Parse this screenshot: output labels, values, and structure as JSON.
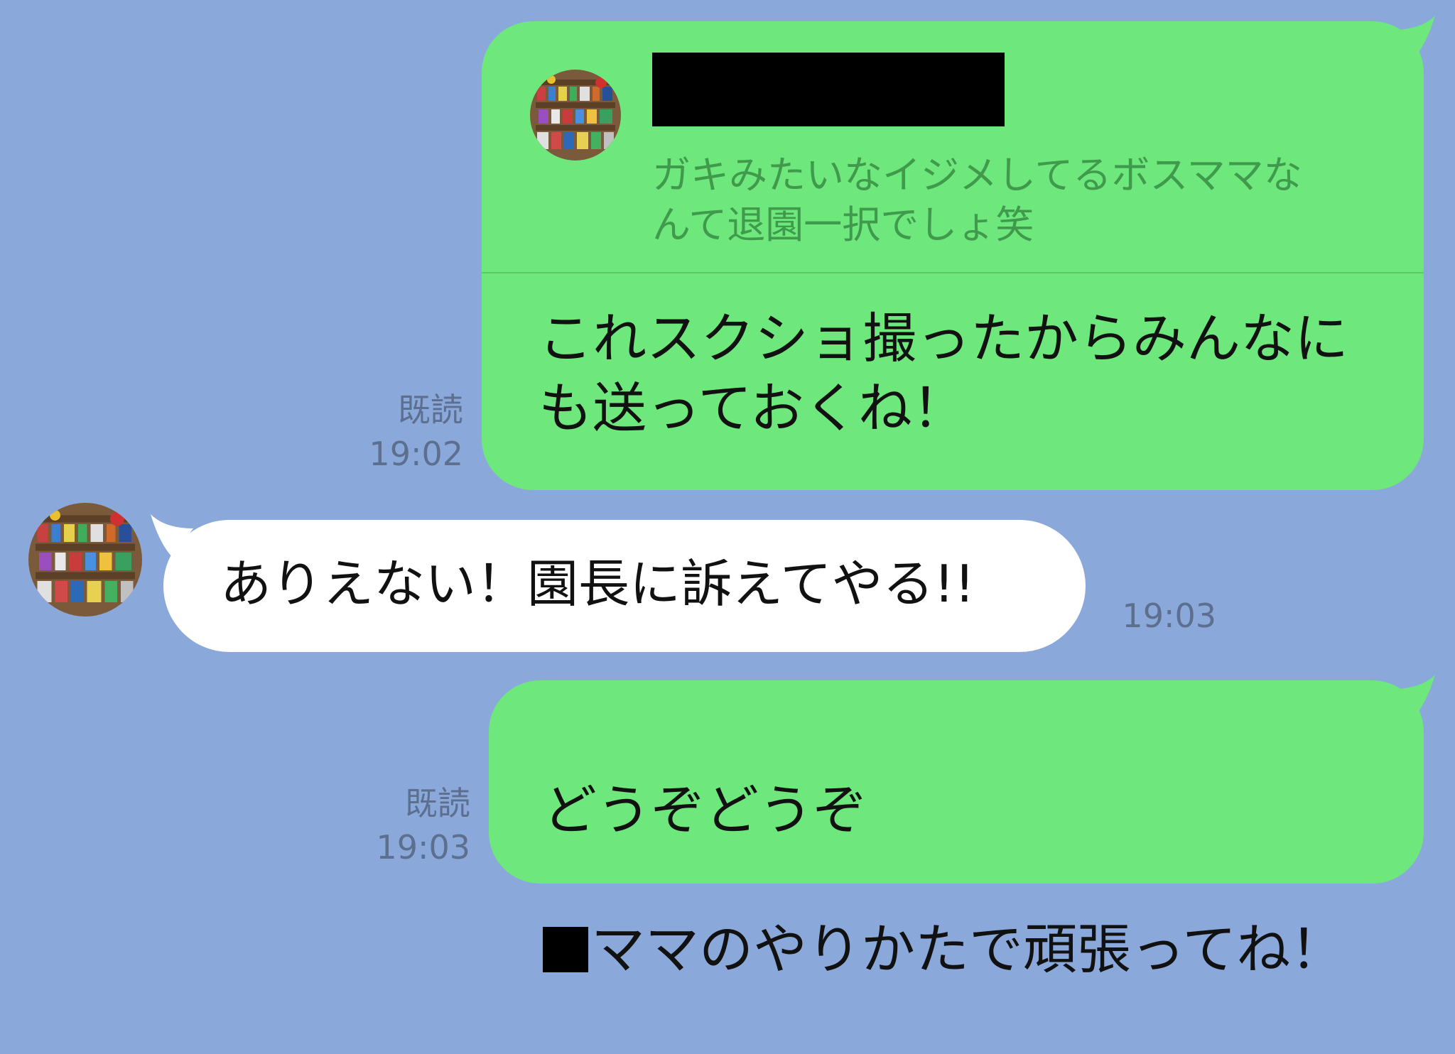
{
  "messages": [
    {
      "direction": "outgoing",
      "quoted_reply": {
        "text": "ガキみたいなイジメしてるボスママな\nんて退園一択でしょ笑"
      },
      "text": "これスクショ撮ったからみんなに\nも送っておくね！",
      "read_label": "既読",
      "time": "19:02"
    },
    {
      "direction": "incoming",
      "text": "ありえない！園長に訴えてやる!!",
      "time": "19:03"
    },
    {
      "direction": "outgoing",
      "text_line1": "どうぞどうぞ",
      "text_line2": "ママのやりかたで頑張ってね！",
      "read_label": "既読",
      "time": "19:03"
    }
  ],
  "colors": {
    "background": "#8aa9da",
    "outgoing_bubble": "#6ee77c",
    "incoming_bubble": "#ffffff",
    "quote_text": "#3f9a4c",
    "meta_text": "#5c6f8f",
    "redaction": "#000000"
  },
  "icons": {
    "avatar": "avatar-icon"
  }
}
